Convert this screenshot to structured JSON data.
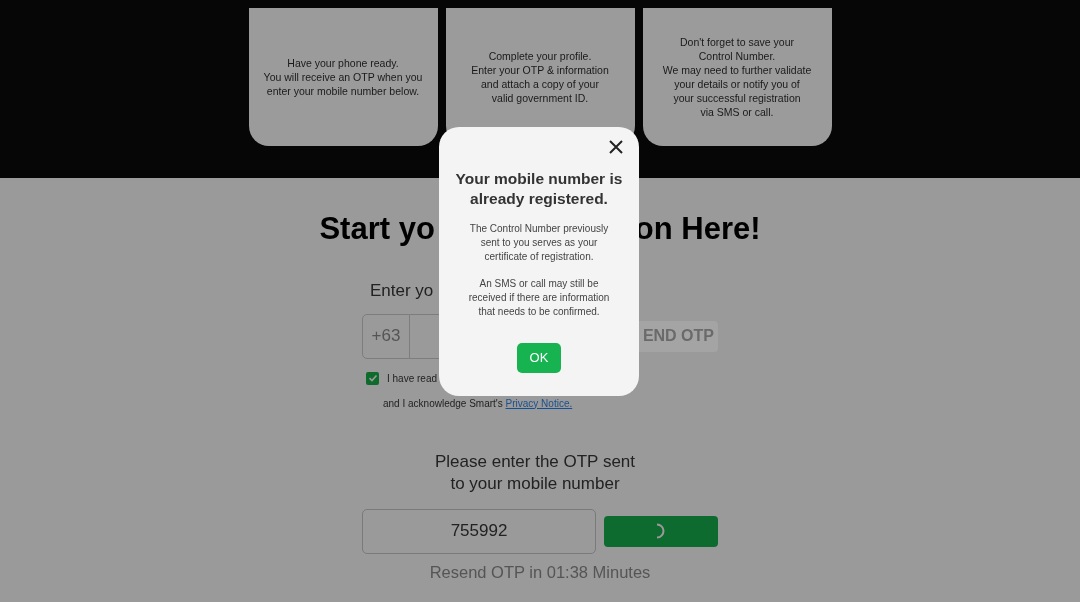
{
  "steps": [
    {
      "text": "Have your phone ready.\nYou will receive an OTP when you\nenter your mobile number below."
    },
    {
      "text": "Complete your profile.\nEnter your OTP & information\nand attach a copy of your\nvalid government ID."
    },
    {
      "text": "Don't forget to save your\nControl Number.\nWe may need to further validate\nyour details or notify you of\nyour successful registration\nvia SMS or call."
    }
  ],
  "heading_parts": [
    "Start yo",
    "on Here!"
  ],
  "phone": {
    "label": "Enter yo",
    "prefix": "+63",
    "button": "END OTP"
  },
  "consent": {
    "checked": true,
    "line1": "I have read",
    "line2": "and I acknowledge Smart's ",
    "link": "Privacy Notice."
  },
  "otp": {
    "label": "Please enter the OTP sent\nto your mobile number",
    "value": "755992",
    "loading": true,
    "resend": "Resend OTP in 01:38 Minutes"
  },
  "modal": {
    "title": "Your mobile number is already registered.",
    "paragraphs": [
      "The Control Number previously\nsent to you serves as your\ncertificate of registration.",
      "An SMS or call may still be\nreceived if there are information\nthat needs to be confirmed."
    ],
    "button": "OK"
  }
}
